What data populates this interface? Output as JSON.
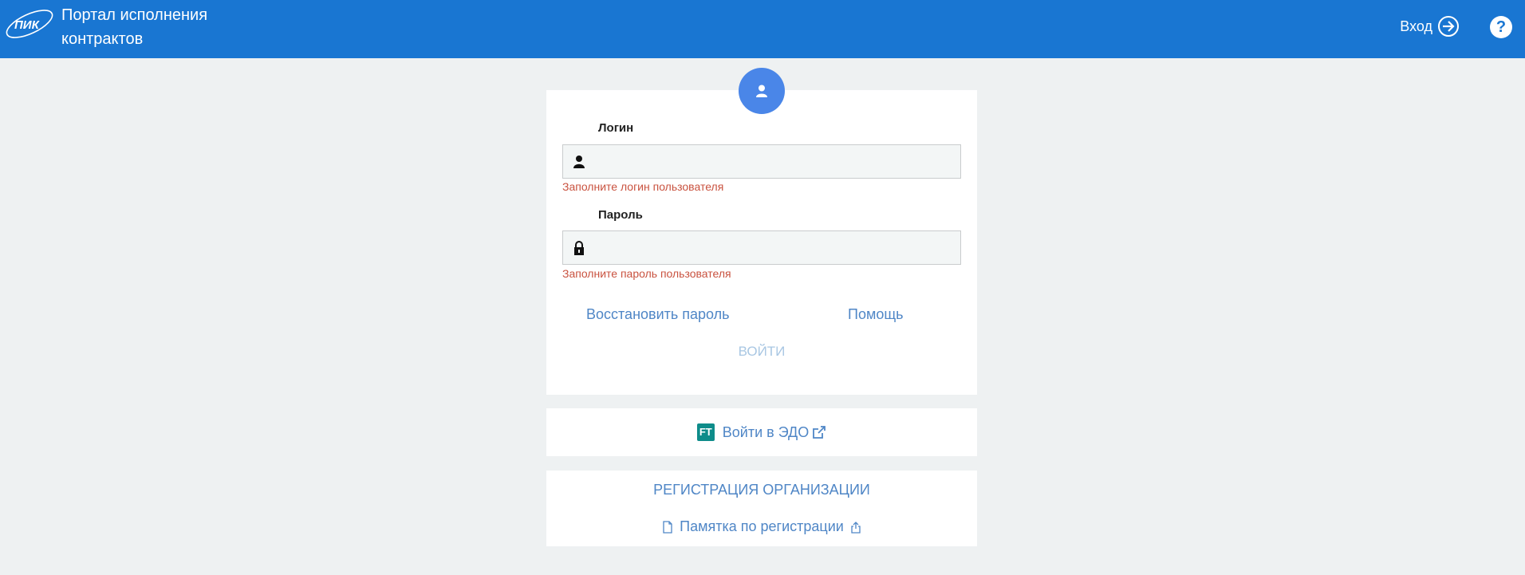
{
  "header": {
    "logo_text": "ПИК",
    "title": "Портал исполнения контрактов",
    "login_label": "Вход",
    "login_icon": "sign-in-icon",
    "help_label": "?"
  },
  "login_form": {
    "avatar_icon": "user-icon",
    "login_label": "Логин",
    "login_value": "",
    "login_placeholder": "",
    "login_error": "Заполните логин пользователя",
    "password_label": "Пароль",
    "password_value": "",
    "password_placeholder": "",
    "password_error": "Заполните пароль пользователя",
    "restore_password": "Восстановить пароль",
    "help": "Помощь",
    "submit": "ВОЙТИ"
  },
  "edo": {
    "icon_text": "FT",
    "label": "Войти в ЭДО"
  },
  "registration": {
    "title": "РЕГИСТРАЦИЯ ОРГАНИЗАЦИИ",
    "memo": "Памятка по регистрации"
  },
  "colors": {
    "header": "#1976d2",
    "accent": "#4f86c6",
    "avatar": "#4a86e8",
    "error": "#c9523f",
    "disabled": "#a9c7e3",
    "edo_icon": "#0e8c8a",
    "background": "#eef1f2"
  }
}
